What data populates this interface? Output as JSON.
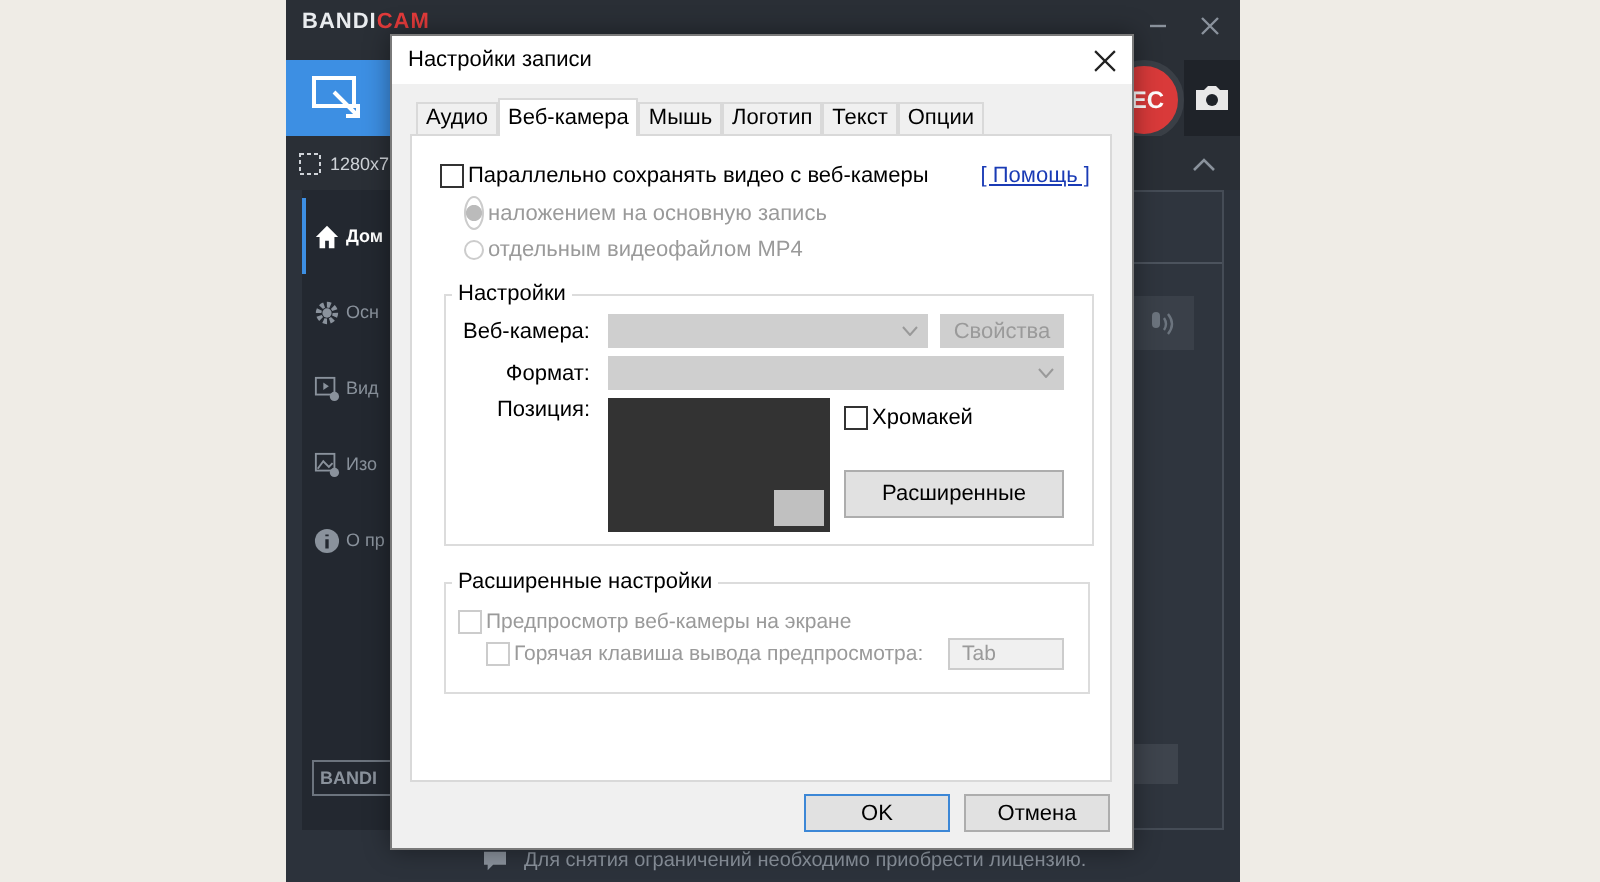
{
  "app": {
    "logo": {
      "primary": "BANDI",
      "accent": "CAM"
    },
    "rec_label": "EC",
    "resolution": "1280x7",
    "nav": [
      {
        "label": "Дом",
        "selected": true
      },
      {
        "label": "Осн",
        "selected": false
      },
      {
        "label": "Вид",
        "selected": false
      },
      {
        "label": "Изо",
        "selected": false
      },
      {
        "label": "О пр",
        "selected": false
      }
    ],
    "bottom_button": "BANDI",
    "status": "Для снятия ограничений необходимо приобрести лицензию."
  },
  "dialog": {
    "title": "Настройки записи",
    "tabs": [
      {
        "label": "Аудио",
        "selected": false
      },
      {
        "label": "Веб-камера",
        "selected": true
      },
      {
        "label": "Мышь",
        "selected": false
      },
      {
        "label": "Логотип",
        "selected": false
      },
      {
        "label": "Текст",
        "selected": false
      },
      {
        "label": "Опции",
        "selected": false
      }
    ],
    "save_parallel": {
      "label": "Параллельно сохранять видео с веб-камеры",
      "checked": false
    },
    "help_link": "[ Помощь ]",
    "modes": [
      {
        "label": "наложением на основную запись",
        "selected": true,
        "disabled": true
      },
      {
        "label": "отдельным видеофайлом MP4",
        "selected": false,
        "disabled": true
      }
    ],
    "settings_group": {
      "title": "Настройки",
      "webcam_label": "Веб-камера:",
      "properties_button": "Свойства",
      "format_label": "Формат:",
      "position_label": "Позиция:",
      "chroma_key": {
        "label": "Хромакей",
        "checked": false
      },
      "advanced_button": "Расширенные"
    },
    "advanced_group": {
      "title": "Расширенные настройки",
      "options": [
        {
          "label": "Предпросмотр веб-камеры на экране",
          "checked": false,
          "disabled": true
        },
        {
          "label": "Горячая клавиша вывода предпросмотра:",
          "checked": false,
          "disabled": true
        }
      ],
      "hotkey_value": "Tab"
    },
    "buttons": [
      {
        "label": "OK",
        "kind": "default"
      },
      {
        "label": "Отмена",
        "kind": "normal"
      }
    ]
  }
}
